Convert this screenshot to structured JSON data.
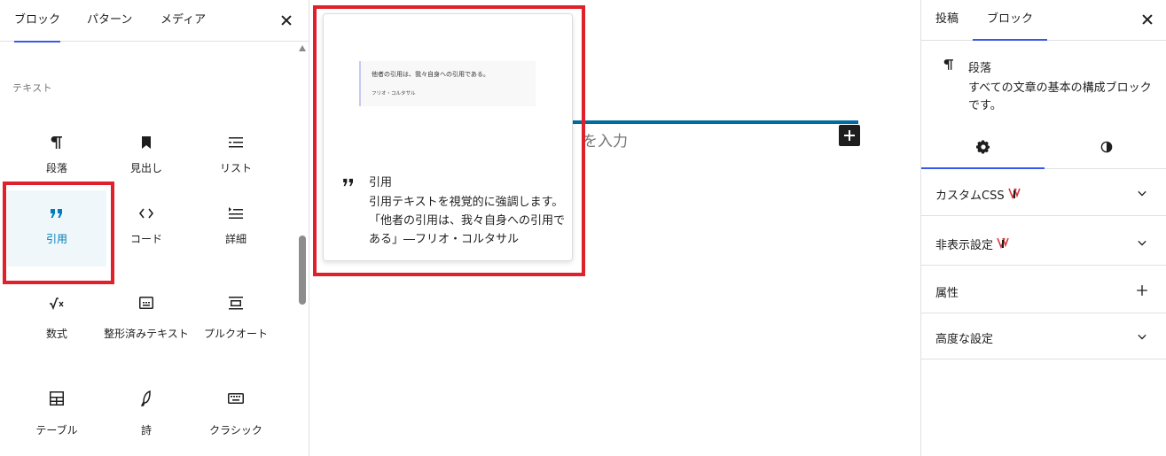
{
  "inserter": {
    "tabs": [
      "ブロック",
      "パターン",
      "メディア"
    ],
    "category": "テキスト",
    "blocks": [
      {
        "label": "段落",
        "icon": "paragraph-icon"
      },
      {
        "label": "見出し",
        "icon": "heading-bookmark-icon"
      },
      {
        "label": "リスト",
        "icon": "list-icon"
      },
      {
        "label": "引用",
        "icon": "quote-icon"
      },
      {
        "label": "コード",
        "icon": "code-icon"
      },
      {
        "label": "詳細",
        "icon": "details-icon"
      },
      {
        "label": "数式",
        "icon": "math-icon"
      },
      {
        "label": "整形済みテキスト",
        "icon": "preformatted-icon"
      },
      {
        "label": "プルクオート",
        "icon": "pullquote-icon"
      },
      {
        "label": "テーブル",
        "icon": "table-icon"
      },
      {
        "label": "詩",
        "icon": "verse-feather-icon"
      },
      {
        "label": "クラシック",
        "icon": "classic-keyboard-icon"
      }
    ]
  },
  "canvas": {
    "placeholder": "を入力"
  },
  "preview": {
    "quote_text": "他者の引用は、我々自身への引用である。",
    "quote_citation": "フリオ・コルタサル",
    "title": "引用",
    "description": "引用テキストを視覚的に強調します。「他者の引用は、我々自身への引用である」―フリオ・コルタサル"
  },
  "sidebar": {
    "tabs": [
      "投稿",
      "ブロック"
    ],
    "block_card": {
      "title": "段落",
      "description": "すべての文章の基本の構成ブロックです。"
    },
    "panels": [
      {
        "label": "カスタムCSS",
        "badge": true,
        "control": "chevron"
      },
      {
        "label": "非表示設定",
        "badge": true,
        "control": "chevron"
      },
      {
        "label": "属性",
        "badge": false,
        "control": "plus"
      },
      {
        "label": "高度な設定",
        "badge": false,
        "control": "chevron"
      }
    ]
  },
  "colors": {
    "accent": "#3858e9",
    "selected_text": "#007cba",
    "highlight_frame": "#e0202a",
    "badge_red": "#d63638"
  }
}
